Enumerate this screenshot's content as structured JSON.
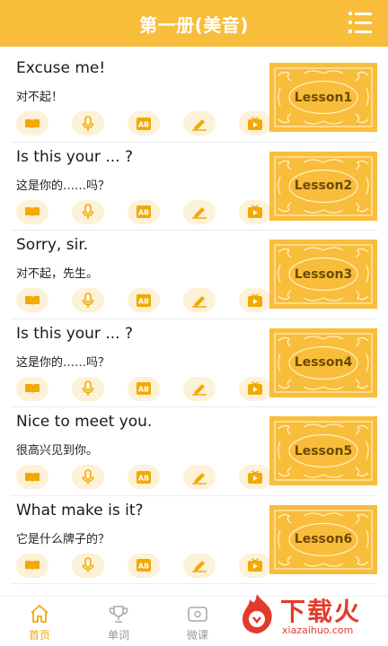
{
  "header": {
    "title": "第一册(美音)"
  },
  "lessons": [
    {
      "title": "Excuse me!",
      "subtitle": "对不起！",
      "cover": "Lesson1"
    },
    {
      "title": "Is this your ... ?",
      "subtitle": "这是你的……吗？",
      "cover": "Lesson2"
    },
    {
      "title": "Sorry, sir.",
      "subtitle": "对不起，先生。",
      "cover": "Lesson3"
    },
    {
      "title": "Is this your ... ?",
      "subtitle": "这是你的……吗？",
      "cover": "Lesson4"
    },
    {
      "title": "Nice to meet you.",
      "subtitle": "很高兴见到你。",
      "cover": "Lesson5"
    },
    {
      "title": "What make is it?",
      "subtitle": "它是什么牌子的？",
      "cover": "Lesson6"
    }
  ],
  "icons": [
    "book-icon",
    "microphone-icon",
    "ab-icon",
    "pencil-icon",
    "video-icon"
  ],
  "tabs": [
    {
      "label": "首页",
      "icon": "home-icon",
      "active": true
    },
    {
      "label": "单词",
      "icon": "trophy-icon",
      "active": false
    },
    {
      "label": "微课",
      "icon": "video-camera-icon",
      "active": false
    }
  ],
  "watermark": {
    "text": "下载火",
    "url": "xiazaihuo.com"
  },
  "colors": {
    "accent": "#f9bd3c",
    "icon_bg": "#fdf1d7",
    "icon_fg": "#f2a900",
    "active_tab": "#f2a900"
  }
}
